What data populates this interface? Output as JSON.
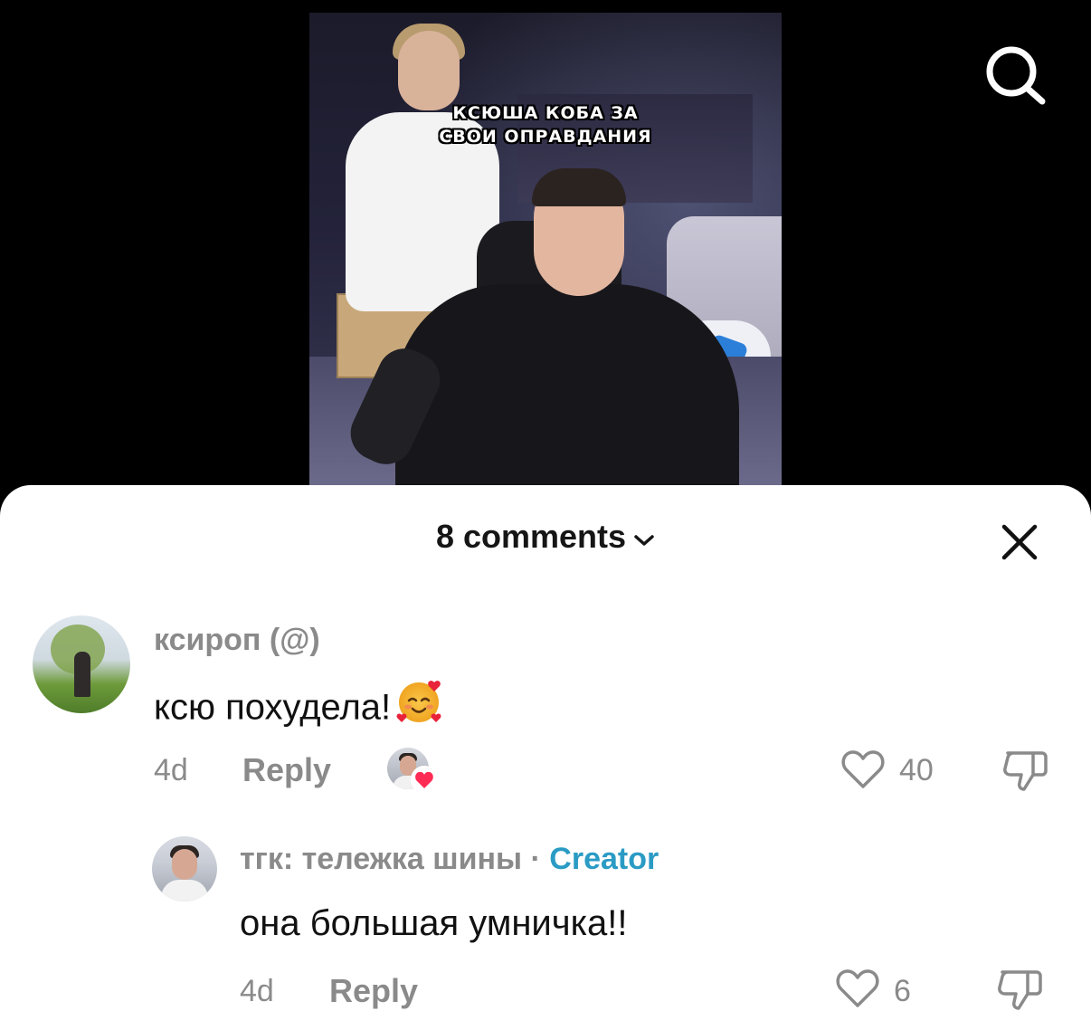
{
  "video": {
    "overlay_line1": "КСЮША КОБА ЗА",
    "overlay_line2": "СВОИ ОПРАВДАНИЯ"
  },
  "search_icon": "search-icon",
  "comments_header": {
    "title": "8 comments",
    "chevron_icon": "chevron-down-icon",
    "close_icon": "close-icon"
  },
  "comments": [
    {
      "username": "ксироп (@)",
      "text": "ксю похудела!",
      "emoji": "smiling-face-with-hearts",
      "time": "4d",
      "reply_label": "Reply",
      "creator_liked": true,
      "like_count": "40"
    },
    {
      "username": "тгк: тележка шины",
      "separator": "·",
      "badge": "Creator",
      "text": "она большая умничка!!",
      "time": "4d",
      "reply_label": "Reply",
      "like_count": "6"
    }
  ],
  "colors": {
    "creator_badge": "#2a9bc4",
    "muted_text": "#8a8a8a",
    "liked_heart": "#fe2c55"
  }
}
